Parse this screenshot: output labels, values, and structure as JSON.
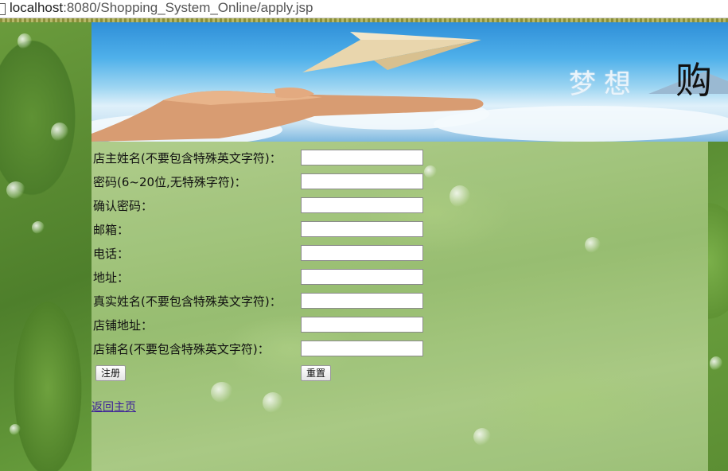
{
  "browser": {
    "url_host": "localhost",
    "url_path": ":8080/Shopping_System_Online/apply.jsp"
  },
  "banner": {
    "slogan_light": "梦想",
    "slogan_dark": "购"
  },
  "form": {
    "fields": [
      {
        "label": "店主姓名(不要包含特殊英文字符)：",
        "value": "",
        "placeholder": ""
      },
      {
        "label": "密码(6~20位,无特殊字符)：",
        "value": "",
        "placeholder": ""
      },
      {
        "label": "确认密码：",
        "value": "",
        "placeholder": ""
      },
      {
        "label": "邮箱：",
        "value": "",
        "placeholder": ""
      },
      {
        "label": "电话：",
        "value": "",
        "placeholder": ""
      },
      {
        "label": "地址：",
        "value": "",
        "placeholder": ""
      },
      {
        "label": "真实姓名(不要包含特殊英文字符)：",
        "value": "",
        "placeholder": ""
      },
      {
        "label": "店铺地址：",
        "value": "",
        "placeholder": ""
      },
      {
        "label": "店铺名(不要包含特殊英文字符)：",
        "value": "",
        "placeholder": ""
      }
    ],
    "register_label": "注册",
    "reset_label": "重置"
  },
  "home_link": "返回主页",
  "colors": {
    "link": "#3b1e9a",
    "page_background": "#7fa55a",
    "content_panel": "#a9c982"
  }
}
